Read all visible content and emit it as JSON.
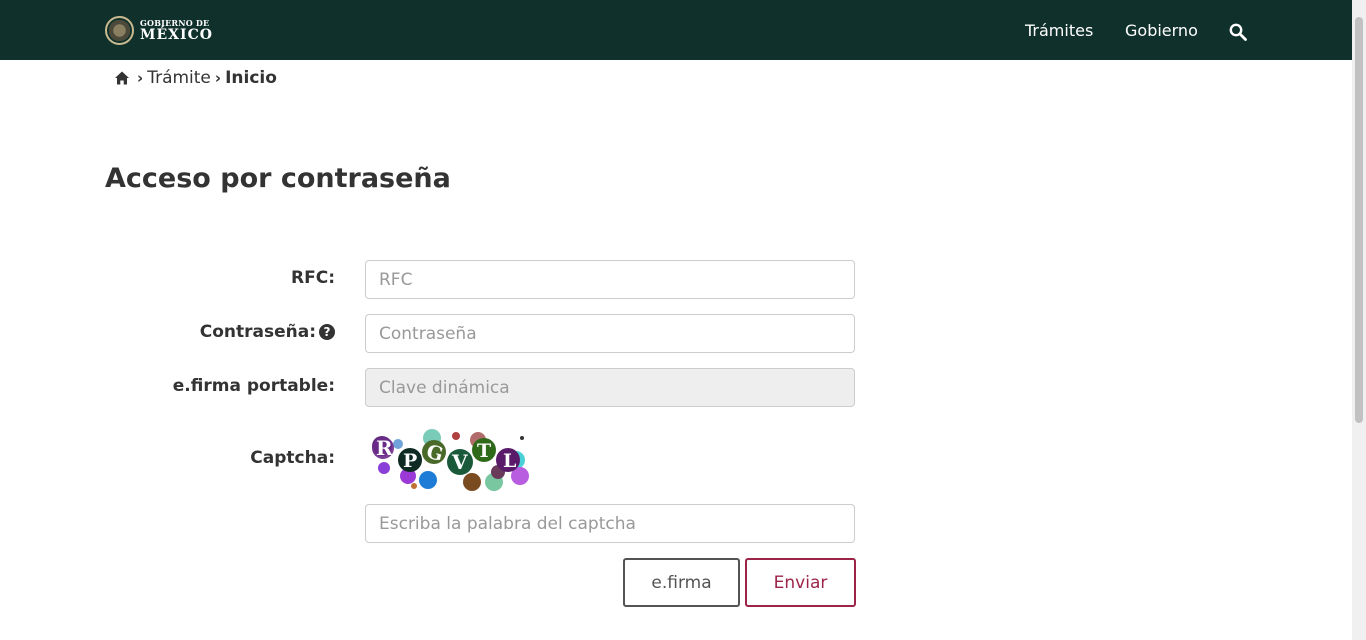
{
  "header": {
    "logo_line1": "GOBIERNO DE",
    "logo_line2": "MÉXICO",
    "nav": [
      "Trámites",
      "Gobierno"
    ],
    "background": "#10312b"
  },
  "breadcrumb": {
    "items": [
      "Trámite",
      "Inicio"
    ]
  },
  "page_title": "Acceso por contraseña",
  "form": {
    "rfc_label": "RFC:",
    "rfc_placeholder": "RFC",
    "password_label": "Contraseña:",
    "password_placeholder": "Contraseña",
    "efirma_label": "e.firma portable:",
    "efirma_placeholder": "Clave dinámica",
    "captcha_label": "Captcha:",
    "captcha_text": "RPGVTL",
    "captcha_placeholder": "Escriba la palabra del captcha"
  },
  "buttons": {
    "efirma": "e.firma",
    "enviar": "Enviar"
  },
  "colors": {
    "accent": "#9d2449",
    "text": "#333333"
  }
}
